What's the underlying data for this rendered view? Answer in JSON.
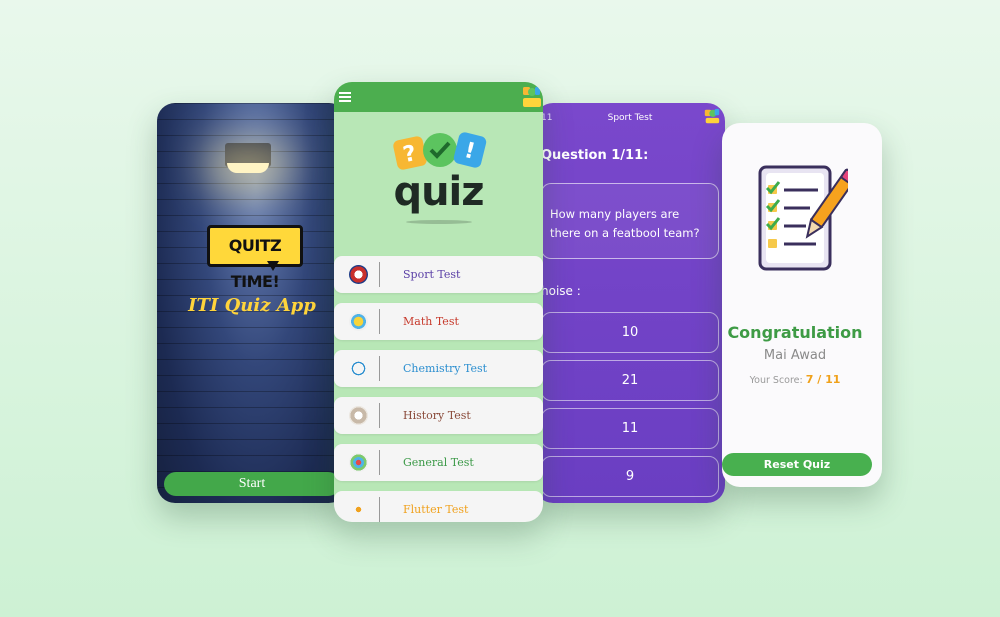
{
  "splash": {
    "badge_text": "QUITZ TIME!",
    "app_title": "ITI Quiz App",
    "start_label": "Start"
  },
  "home": {
    "logo_text": "quiz",
    "items": [
      {
        "label": "Sport Test",
        "color": "#5a3fa6",
        "icon": "soccer-ball-icon"
      },
      {
        "label": "Math Test",
        "color": "#c73a2c",
        "icon": "lightbulb-icon"
      },
      {
        "label": "Chemistry Test",
        "color": "#2c8fd0",
        "icon": "flask-icon"
      },
      {
        "label": "History Test",
        "color": "#8a4a3a",
        "icon": "history-icon"
      },
      {
        "label": "General Test",
        "color": "#3d9a49",
        "icon": "general-icon"
      },
      {
        "label": "Flutter Test",
        "color": "#f0a21f",
        "icon": "code-icon"
      }
    ]
  },
  "question": {
    "counter": "11",
    "title": "Sport Test",
    "label": "Question 1/11:",
    "text": "How many players are there on a featbool team?",
    "choice_label": "hoise :",
    "options": [
      "10",
      "21",
      "11",
      "9"
    ]
  },
  "result": {
    "heading": "Congratulation",
    "name": "Mai Awad",
    "score_label": "Your Score:",
    "score_value": "7 / 11",
    "reset_label": "Reset Quiz"
  },
  "colors": {
    "green": "#4cae4f",
    "purple": "#6a3ec2",
    "gold": "#ffd43b"
  }
}
